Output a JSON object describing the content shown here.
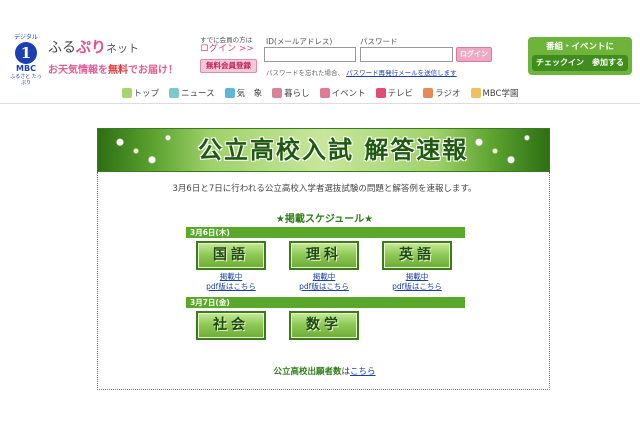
{
  "header": {
    "logo": {
      "small": "デジタル",
      "number": "1",
      "mbc": "MBC",
      "sub": "ふるさと たっぷり"
    },
    "brand": {
      "prefix": "ふる",
      "accent": "ぷり",
      "suffix": "ネット"
    },
    "tagline": {
      "pre": "お天気情報を",
      "highlight": "無料",
      "post": "でお届け！"
    },
    "member": {
      "note": "すでに会員の方は",
      "login_link": "ログイン >>",
      "register": "無料会員登録"
    },
    "login_form": {
      "id_label": "ID(メールアドレス)",
      "pw_label": "パスワード",
      "login_button": "ログイン",
      "forgot_text": "パスワードを忘れた場合、",
      "forgot_link": "パスワード再発行メールを送信します"
    },
    "event": {
      "title": "番組・イベントに",
      "button": "チェックイン　参加する"
    }
  },
  "nav": {
    "items": [
      {
        "label": "トップ",
        "color": "#a7d46f"
      },
      {
        "label": "ニュース",
        "color": "#7fc7c9"
      },
      {
        "label": "気　象",
        "color": "#5fb6d8"
      },
      {
        "label": "暮らし",
        "color": "#d9839b"
      },
      {
        "label": "イベント",
        "color": "#e07a95"
      },
      {
        "label": "テレビ",
        "color": "#e04c73"
      },
      {
        "label": "ラジオ",
        "color": "#e88a55"
      },
      {
        "label": "MBC学園",
        "color": "#f0c060"
      }
    ]
  },
  "main": {
    "banner_title": "公立高校入試 解答速報",
    "intro": "3月6日と7日に行われる公立高校入学者選抜試験の問題と解答例を速報します。",
    "schedule_title": "★掲載スケジュール★",
    "days": [
      {
        "label": "3月6日(木)",
        "subjects": [
          {
            "name": "国語",
            "status": "掲載中",
            "pdf": "pdf版はこちら"
          },
          {
            "name": "理科",
            "status": "掲載中",
            "pdf": "pdf版はこちら"
          },
          {
            "name": "英語",
            "status": "掲載中",
            "pdf": "pdf版はこちら"
          }
        ]
      },
      {
        "label": "3月7日(金)",
        "subjects": [
          {
            "name": "社会"
          },
          {
            "name": "数学"
          }
        ]
      }
    ],
    "counts": {
      "bold": "公立高校出願者数",
      "mid": "は",
      "link": "こちら"
    }
  }
}
